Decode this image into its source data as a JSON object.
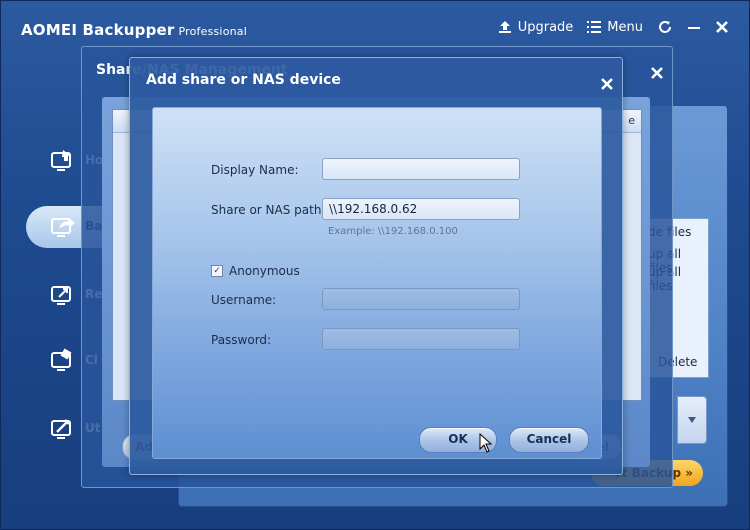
{
  "app": {
    "title": "AOMEI Backupper",
    "edition": "Professional",
    "upgrade_label": "Upgrade",
    "menu_label": "Menu"
  },
  "sidebar": {
    "items": [
      {
        "label": "Ho",
        "icon": "home-icon"
      },
      {
        "label": "Ba",
        "icon": "backup-icon"
      },
      {
        "label": "Re",
        "icon": "restore-icon"
      },
      {
        "label": "Cl",
        "icon": "clone-icon"
      },
      {
        "label": "Ut",
        "icon": "utilities-icon"
      }
    ]
  },
  "background_panel": {
    "files_lines": [
      "de files",
      "up all files",
      "up all files"
    ],
    "delete_label": "Delete",
    "start_backup_label": "rt Backup »"
  },
  "management_window": {
    "title": "Share/NAS Management",
    "list_header": "e",
    "add_label": "Ad",
    "cancel_label": "ncel"
  },
  "dialog": {
    "title": "Add share or NAS device",
    "display_name_label": "Display Name:",
    "display_name_value": "",
    "path_label": "Share or NAS path:",
    "path_value": "\\\\192.168.0.62",
    "path_hint": "Example: \\\\192.168.0.100",
    "anonymous_label": "Anonymous",
    "anonymous_checked": true,
    "username_label": "Username:",
    "username_value": "",
    "password_label": "Password:",
    "password_value": "",
    "ok_label": "OK",
    "cancel_label": "Cancel"
  },
  "colors": {
    "window_bg": "#1e4a8f",
    "dialog_gradient_top": "#cfe1f6",
    "start_backup": "#f0a51c"
  }
}
